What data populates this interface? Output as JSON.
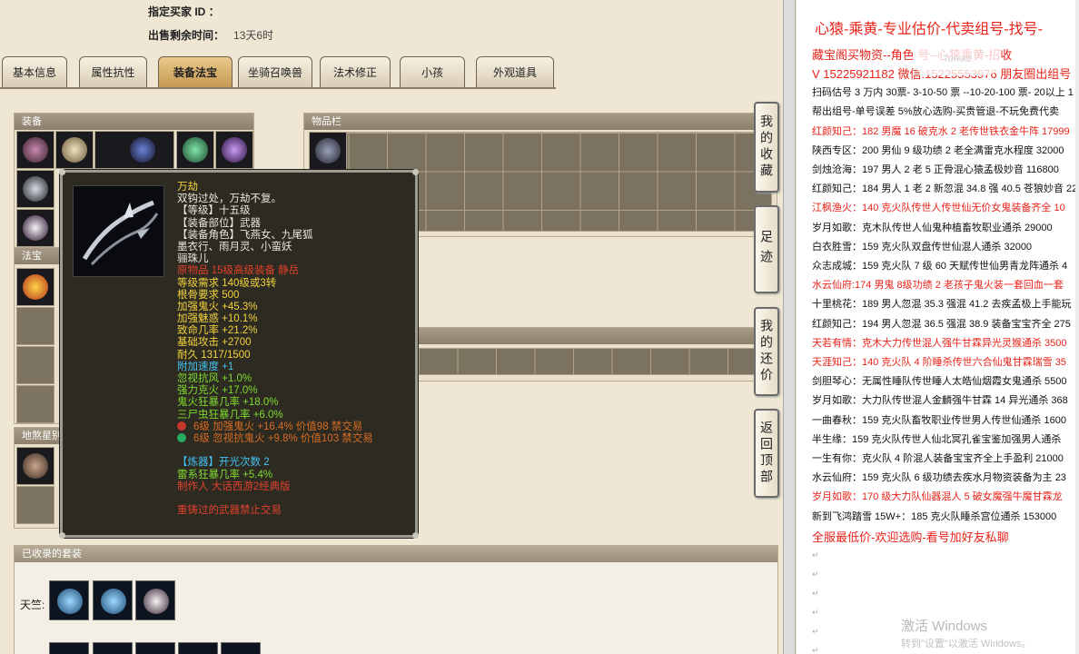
{
  "seller": {
    "buyer_id_label": "指定买家 ID ：",
    "remain_label": "出售剩余时间：",
    "remain_value": "13天6时"
  },
  "tabs": [
    {
      "label": "基本信息"
    },
    {
      "label": "属性抗性"
    },
    {
      "label": "装备法宝"
    },
    {
      "label": "坐骑召唤兽"
    },
    {
      "label": "法术修正"
    },
    {
      "label": "小孩"
    },
    {
      "label": "外观道具"
    }
  ],
  "panels": {
    "equip": "装备",
    "magic": "法宝",
    "land": "地煞星别",
    "bag": "物品栏"
  },
  "side_buttons": [
    {
      "label": "我的收藏"
    },
    {
      "label": "足迹"
    },
    {
      "label": "我的还价"
    },
    {
      "label": "返回顶部"
    }
  ],
  "tooltip": {
    "lines": [
      {
        "text": "万劫",
        "color": "y"
      },
      {
        "text": "双钩过处，万劫不复。",
        "color": "w"
      },
      {
        "text": "【等级】十五级",
        "color": "w"
      },
      {
        "text": "【装备部位】武器",
        "color": "w"
      },
      {
        "text": "【装备角色】飞燕女、九尾狐",
        "color": "w"
      },
      {
        "text": "墨衣行、雨月灵、小蛮妖",
        "color": "w"
      },
      {
        "text": "骊珠儿",
        "color": "w"
      },
      {
        "text": "原物品 15级高级装备 静岳",
        "color": "r"
      },
      {
        "text": "等级需求 140级或3转",
        "color": "y"
      },
      {
        "text": "根骨要求 500",
        "color": "y"
      },
      {
        "text": "加强鬼火 +45.3%",
        "color": "y"
      },
      {
        "text": "加强魅惑 +10.1%",
        "color": "y"
      },
      {
        "text": "致命几率 +21.2%",
        "color": "y"
      },
      {
        "text": "基础攻击 +2700",
        "color": "y"
      },
      {
        "text": "耐久 1317/1500",
        "color": "y"
      },
      {
        "text": "附加速度 +1",
        "color": "c"
      },
      {
        "text": "忽视抗风 +1.0%",
        "color": "g"
      },
      {
        "text": "强力克火 +17.0%",
        "color": "g"
      },
      {
        "text": "鬼火狂暴几率 +18.0%",
        "color": "g"
      },
      {
        "text": "三尸虫狂暴几率 +6.0%",
        "color": "g"
      },
      {
        "text": "6级 加强鬼火 +16.4% 价值98 禁交易",
        "color": "o",
        "gem": "#c0392b"
      },
      {
        "text": "6级 忽视抗鬼火 +9.8% 价值103 禁交易",
        "color": "o",
        "gem": "#27ae60"
      },
      {
        "text": "",
        "color": "w"
      },
      {
        "text": "【炼器】开光次数 2",
        "color": "c"
      },
      {
        "text": "雷系狂暴几率 +5.4%",
        "color": "g"
      },
      {
        "text": "制作人 大话西游2经典版",
        "color": "r"
      },
      {
        "text": "",
        "color": "w"
      },
      {
        "text": "重铸过的武器禁止交易",
        "color": "r"
      }
    ]
  },
  "suite": {
    "title": "已收录的套装",
    "label": "天竺:"
  },
  "doc": {
    "title": "心猿-乘黄-专业估价-代卖组号-找号-",
    "lines": [
      {
        "text": "藏宝阁买物资--角色 号--心猿乘黄-招收",
        "red": true,
        "big": true
      },
      {
        "text": "V 15225921182 微信:15225553976 朋友圈出组号",
        "red": true,
        "big": true
      },
      {
        "text": "扫码估号 3 万内 30票- 3-10-50 票 --10-20-100 票- 20以上 1",
        "red": false
      },
      {
        "text": "帮出组号-单号误差 5%放心选购-买贵管退-不玩免费代卖",
        "red": false
      },
      {
        "text": "红颜知己：182 男魔 16 破克水 2 老传世铁衣金牛阵 17999",
        "red": true
      },
      {
        "text": "陕西专区：200 男仙 9 级功绩 2 老全满雷克水程度 32000",
        "red": false
      },
      {
        "text": "剑烛沧海：197 男人 2 老 5 正骨混心猿孟极妙音 116800",
        "red": false
      },
      {
        "text": "红颜知己：184 男人 1 老 2 新忽混 34.8 强 40.5 苍狼妙音 22",
        "red": false
      },
      {
        "text": "江枫渔火：140 克火队传世人传世仙无价女鬼装备齐全 10",
        "red": true
      },
      {
        "text": "岁月如歌：克木队传世人仙鬼种植畜牧职业通杀 29000",
        "red": false
      },
      {
        "text": "白衣胜雪：159 克火队双盘传世仙混人通杀 32000",
        "red": false
      },
      {
        "text": "众志成城：159 克火队 7 级 60 天赋传世仙男青龙阵通杀 4",
        "red": false
      },
      {
        "text": "水云仙府:174 男鬼 8级功绩 2 老孩子鬼火装一套回血一套",
        "red": true
      },
      {
        "text": "十里桃花：189 男人忽混 35.3 强混 41.2 去疾孟极上手能玩",
        "red": false
      },
      {
        "text": "红颜知己：194 男人忽混 36.5 强混 38.9 装备宝宝齐全 275",
        "red": false
      },
      {
        "text": "天若有情：克木大力传世混人强牛甘霖异光灵猴通杀 3500",
        "red": true
      },
      {
        "text": "天涯知己：140 克火队 4 阶睡杀传世六合仙鬼甘霖瑞雪 35",
        "red": true
      },
      {
        "text": "剑胆琴心：无属性睡队传世睡人太皓仙烟霞女鬼通杀 5500",
        "red": false
      },
      {
        "text": "岁月如歌：大力队传世混人金麟强牛甘霖 14 异光通杀 368",
        "red": false
      },
      {
        "text": "一曲春秋：159 克火队畜牧职业传世男人传世仙通杀 1600",
        "red": false
      },
      {
        "text": "半生缘：159 克火队传世人仙北冥孔雀宝鉴加强男人通杀",
        "red": false
      },
      {
        "text": "一生有你：克火队 4 阶混人装备宝宝齐全上手盈利 21000",
        "red": false
      },
      {
        "text": "水云仙府：159 克火队 6 级功绩去疾水月物资装备为主 23",
        "red": false
      },
      {
        "text": "岁月如歌：170 级大力队仙器混人 5 破女魔强牛魔甘霖龙",
        "red": true
      },
      {
        "text": "新到飞鸿踏雪 15W+：185 克火队睡杀宫位通杀 153000",
        "red": false
      },
      {
        "text": "全服最低价-欢迎选购-看号加好友私聊",
        "red": true,
        "big": true
      }
    ],
    "watermark": "激活 Windows",
    "watermark_sub": "转到\"设置\"以激活 Windows。",
    "logo": "Tomxz",
    "para_mark": "↵"
  }
}
